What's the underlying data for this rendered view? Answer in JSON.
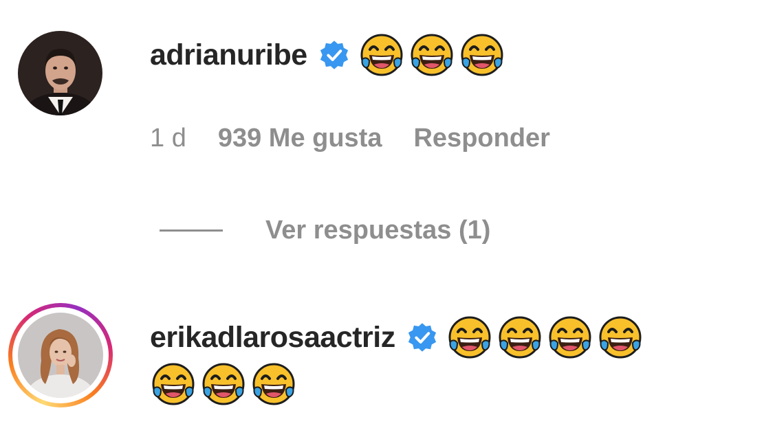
{
  "comments": [
    {
      "username": "adrianuribe",
      "verified": true,
      "emojis": [
        "face-with-tears-of-joy",
        "face-with-tears-of-joy",
        "face-with-tears-of-joy"
      ],
      "time": "1 d",
      "likes": "939 Me gusta",
      "reply_label": "Responder",
      "view_replies": "Ver respuestas (1)"
    },
    {
      "username": "erikadlarosaactriz",
      "verified": true,
      "has_story_ring": true,
      "emojis": [
        "face-with-tears-of-joy",
        "face-with-tears-of-joy",
        "face-with-tears-of-joy",
        "face-with-tears-of-joy",
        "face-with-tears-of-joy",
        "face-with-tears-of-joy",
        "face-with-tears-of-joy"
      ]
    }
  ],
  "colors": {
    "verified_blue": "#3897f0",
    "text_primary": "#262626",
    "text_secondary": "#8e8e8e",
    "emoji_yellow": "#f8c02b",
    "tear_blue": "#3aa3e3"
  }
}
